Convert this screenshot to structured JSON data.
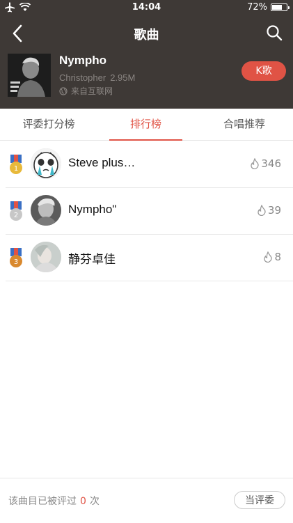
{
  "status_bar": {
    "time": "14:04",
    "battery_text": "72%",
    "battery_level": 0.72
  },
  "nav": {
    "title": "歌曲"
  },
  "song": {
    "title": "Nympho",
    "artist": "Christopher",
    "plays": "2.95M",
    "source": "来自互联网",
    "k_button": "K歌"
  },
  "tabs": [
    {
      "label": "评委打分榜",
      "active": false
    },
    {
      "label": "排行榜",
      "active": true
    },
    {
      "label": "合唱推荐",
      "active": false
    }
  ],
  "ranking": [
    {
      "rank": "1",
      "name": "Steve plus…",
      "score": "346",
      "medal_color": "#e8b93a"
    },
    {
      "rank": "2",
      "name": "Nympho\"",
      "score": "39",
      "medal_color": "#c7c7c7"
    },
    {
      "rank": "3",
      "name": "静芬卓佳",
      "score": "8",
      "medal_color": "#d9892e"
    }
  ],
  "footer": {
    "prefix": "该曲目已被评过",
    "count": "0",
    "suffix": "次",
    "judge_button": "当评委"
  },
  "colors": {
    "accent": "#e05345",
    "header_bg": "#3e3936"
  }
}
